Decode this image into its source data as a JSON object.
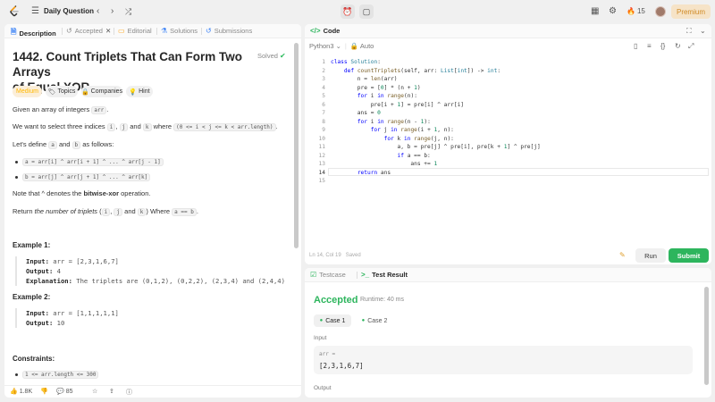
{
  "topbar": {
    "title": "Daily Question",
    "streak_count": "15",
    "premium_label": "Premium",
    "colors": {
      "premium_bg": "#f6e3c7",
      "premium_text": "#d08a25",
      "logo": "#ffa116"
    }
  },
  "left_tabs": [
    {
      "label": "Description"
    },
    {
      "label": "Accepted"
    },
    {
      "label": "Editorial"
    },
    {
      "label": "Solutions"
    },
    {
      "label": "Submissions"
    }
  ],
  "problem": {
    "title_line1": "1442. Count Triplets That Can Form Two Arrays",
    "title_line2": "of Equal XOR",
    "status": "Solved",
    "difficulty": "Medium",
    "chips": [
      "Topics",
      "Companies",
      "Hint"
    ],
    "p1_prefix": "Given an array of integers ",
    "p1_code": "arr",
    "p1_suffix": ".",
    "p2_prefix": "We want to select three indices ",
    "p2_i": "i",
    "p2_j": "j",
    "p2_and": "and",
    "p2_k": "k",
    "p2_where": "where",
    "p2_cond": "(0 <= i < j <= k < arr.length)",
    "p2_suffix": ".",
    "p3_prefix": "Let's define ",
    "p3_a": "a",
    "p3_and": "and",
    "p3_b": "b",
    "p3_suffix": "as follows:",
    "bullet1": "a = arr[i] ^ arr[i + 1] ^ ... ^ arr[j - 1]",
    "bullet2": "b = arr[j] ^ arr[j + 1] ^ ... ^ arr[k]",
    "p4_prefix": "Note that ",
    "p4_caret": "^",
    "p4_mid": " denotes the ",
    "p4_bold": "bitwise-xor",
    "p4_suffix": " operation.",
    "p5_prefix": "Return ",
    "p5_italic": "the number of triplets",
    "p5_mid1": " (",
    "p5_i": "i",
    "p5_comma1": ", ",
    "p5_j": "j",
    "p5_and": " and ",
    "p5_k": "k",
    "p5_mid2": ") Where ",
    "p5_cond": "a == b",
    "p5_suffix": "."
  },
  "examples": [
    {
      "heading": "Example 1:",
      "input_label": "Input:",
      "input": "arr = [2,3,1,6,7]",
      "output_label": "Output:",
      "output": "4",
      "explanation_label": "Explanation:",
      "explanation": "The triplets are (0,1,2), (0,2,2), (2,3,4) and (2,4,4)"
    },
    {
      "heading": "Example 2:",
      "input_label": "Input:",
      "input": "arr = [1,1,1,1,1]",
      "output_label": "Output:",
      "output": "10"
    }
  ],
  "constraints": {
    "heading": "Constraints:",
    "item1": "1 <= arr.length <= 300"
  },
  "footer": {
    "likes": "1.8K",
    "comments": "85"
  },
  "code_panel": {
    "title": "Code",
    "language": "Python3",
    "auto_label": "Auto",
    "status_line": "Ln 14, Col 19",
    "saved_label": "Saved",
    "run_label": "Run",
    "submit_label": "Submit",
    "line_numbers": [
      "1",
      "2",
      "3",
      "4",
      "5",
      "6",
      "7",
      "8",
      "9",
      "10",
      "11",
      "12",
      "13",
      "14",
      "15"
    ],
    "lines": [
      "class Solution:",
      "    def countTriplets(self, arr: List[int]) -> int:",
      "        n = len(arr)",
      "        pre = [0] * (n + 1)",
      "        for i in range(n):",
      "            pre[i + 1] = pre[i] ^ arr[i]",
      "        ans = 0",
      "        for i in range(n - 1):",
      "            for j in range(i + 1, n):",
      "                for k in range(j, n):",
      "                    a, b = pre[j] ^ pre[i], pre[k + 1] ^ pre[j]",
      "                    if a == b:",
      "                        ans += 1",
      "        return ans",
      ""
    ]
  },
  "result_panel": {
    "testcase_tab": "Testcase",
    "result_tab": "Test Result",
    "status": "Accepted",
    "runtime": "Runtime: 40 ms",
    "cases": [
      "Case 1",
      "Case 2"
    ],
    "input_label": "Input",
    "var_name": "arr =",
    "var_value": "[2,3,1,6,7]",
    "output_label": "Output",
    "accent": "#2db55d"
  }
}
